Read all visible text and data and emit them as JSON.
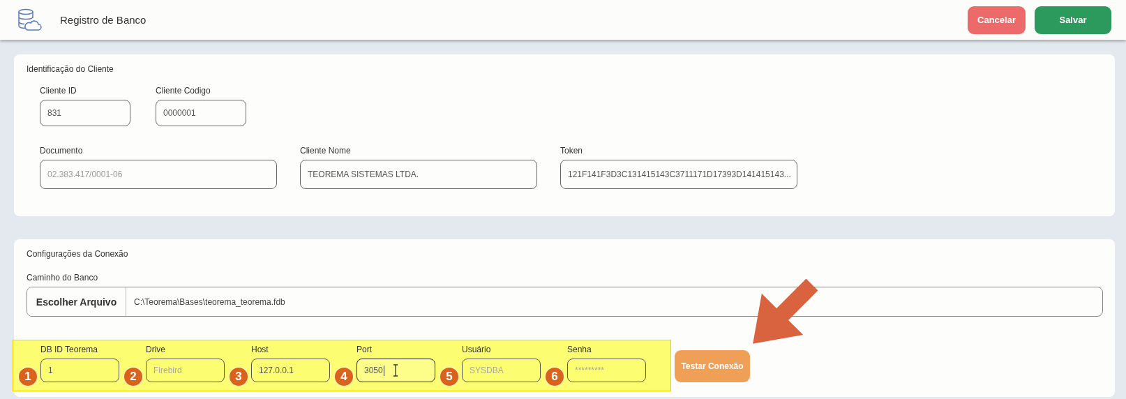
{
  "header": {
    "title": "Registro de Banco",
    "buttons": [
      {
        "label": "Cancelar",
        "kind": "cancel"
      },
      {
        "label": "Salvar",
        "kind": "save"
      }
    ]
  },
  "client_section": {
    "title": "Identificação do Cliente",
    "rows": [
      [
        {
          "label": "Cliente ID",
          "value": "831"
        },
        {
          "label": "Cliente Codigo",
          "value": "0000001"
        }
      ],
      [
        {
          "label": "Documento",
          "value": "02.383.417/0001-06",
          "disabled": true
        },
        {
          "label": "Cliente Nome",
          "value": "TEOREMA SISTEMAS LTDA.",
          "disabled": false
        },
        {
          "label": "Token",
          "value": "121F141F3D3C131415143C3711171D17393D141415143...",
          "disabled": false
        }
      ]
    ]
  },
  "connection_section": {
    "title": "Configurações da Conexão",
    "path_field": {
      "label": "Caminho do Banco",
      "button": "Escolher Arquivo",
      "value": "C:\\Teorema\\Bases\\teorema_teorema.fdb"
    },
    "highlighted": true,
    "fields": [
      {
        "label": "DB ID Teorema",
        "value": "1",
        "badge": "1",
        "focused": false
      },
      {
        "label": "Drive",
        "placeholder": "Firebird",
        "badge": "2",
        "focused": false
      },
      {
        "label": "Host",
        "value": "127.0.0.1",
        "badge": "3",
        "focused": false
      },
      {
        "label": "Port",
        "value": "3050",
        "badge": "4",
        "focused": true
      },
      {
        "label": "Usuário",
        "placeholder": "SYSDBA",
        "badge": "5",
        "focused": false
      },
      {
        "label": "Senha",
        "placeholder": "*********",
        "badge": "6",
        "focused": false
      }
    ],
    "test_button": {
      "label": "Testar Conexão",
      "pointed": true
    }
  }
}
